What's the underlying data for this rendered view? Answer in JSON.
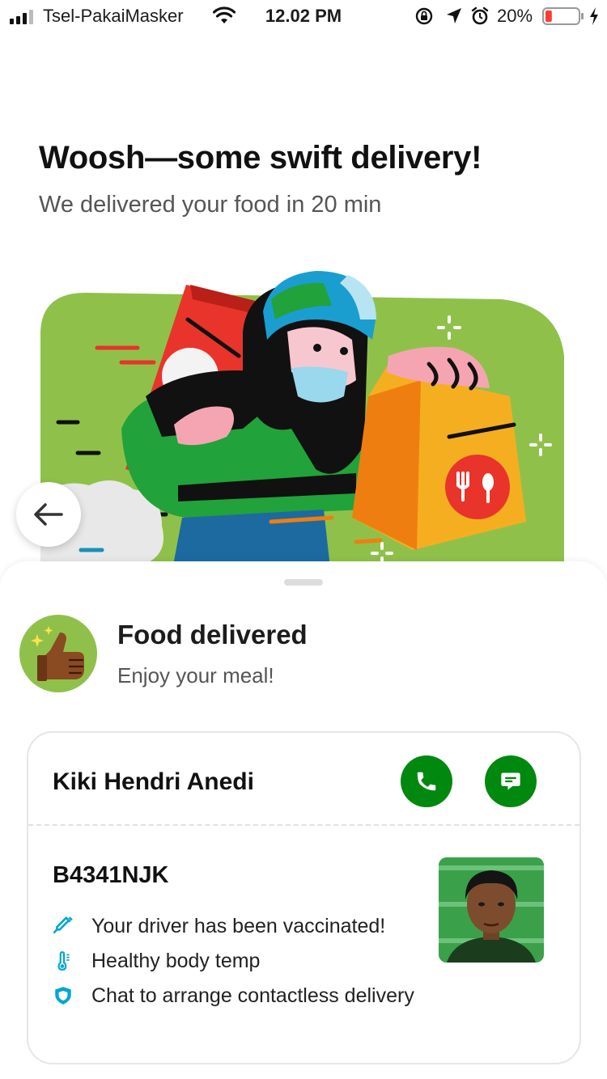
{
  "status_bar": {
    "carrier": "Tsel-PakaiMasker",
    "time": "12.02 PM",
    "battery": "20%",
    "battery_level": 0.2,
    "battery_color": "#ff3b30"
  },
  "hero": {
    "title": "Woosh—some swift delivery!",
    "subtitle": "We delivered your food in 20 min"
  },
  "order_status": {
    "title": "Food delivered",
    "subtitle": "Enjoy your meal!",
    "icon": "thumbs-up-icon"
  },
  "driver": {
    "name": "Kiki Hendri Anedi",
    "plate": "B4341NJK",
    "call_icon": "phone-icon",
    "chat_icon": "chat-icon",
    "safety": [
      {
        "icon": "syringe-icon",
        "text": "Your driver has been vaccinated!"
      },
      {
        "icon": "thermometer-icon",
        "text": "Healthy body temp"
      },
      {
        "icon": "shield-icon",
        "text": "Chat to arrange contactless delivery"
      }
    ]
  },
  "colors": {
    "brand_green": "#00880f",
    "illustration_green": "#8fc14a",
    "safety_icon_blue": "#00a6d6"
  }
}
